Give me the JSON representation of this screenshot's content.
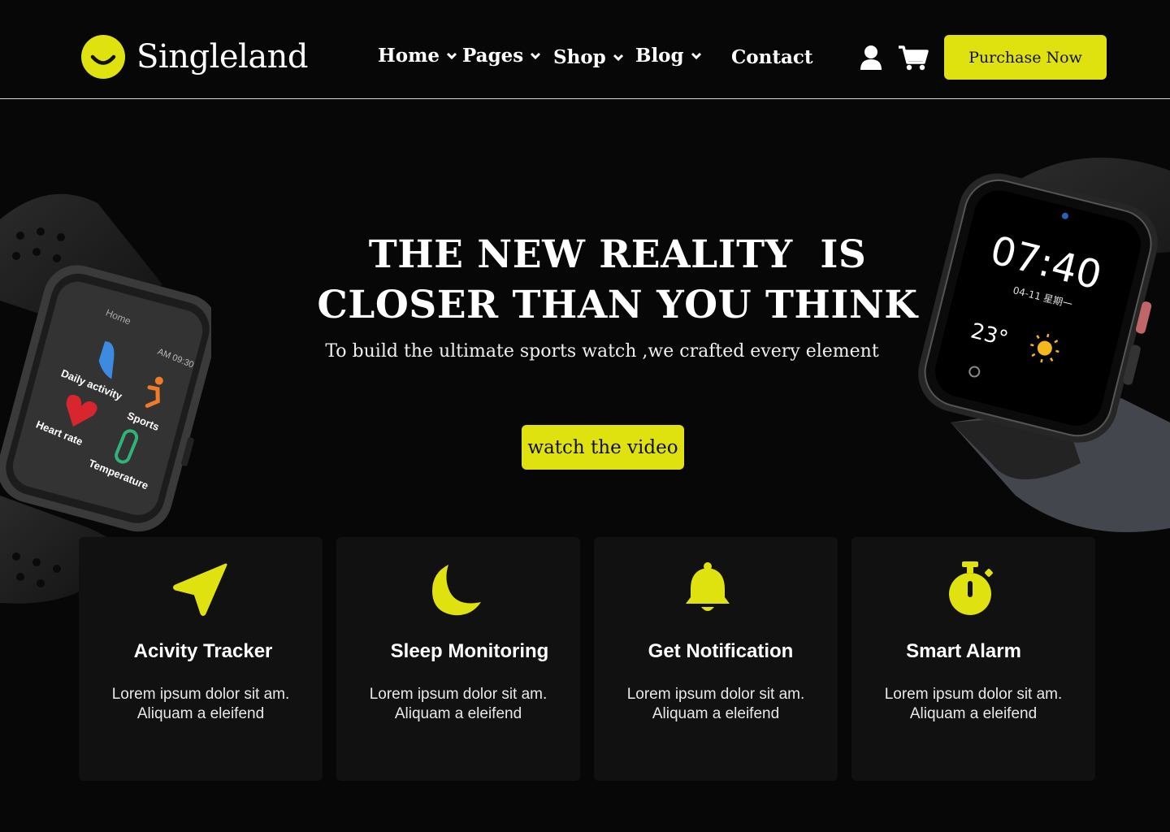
{
  "brand": {
    "name": "Singleland",
    "accent": "#dfe20f",
    "background": "#070707"
  },
  "nav": {
    "items": [
      {
        "label": "Home",
        "has_dropdown": true
      },
      {
        "label": "Pages",
        "has_dropdown": true
      },
      {
        "label": "Shop",
        "has_dropdown": true
      },
      {
        "label": "Blog",
        "has_dropdown": true
      },
      {
        "label": "Contact",
        "has_dropdown": false
      }
    ],
    "icons": [
      "user-icon",
      "cart-icon"
    ],
    "purchase_label": "Purchase Now"
  },
  "hero": {
    "title_line1": "THE NEW REALITY  IS",
    "title_line2": "CLOSER THAN YOU THINK",
    "subtitle": "To build the ultimate sports watch ,we crafted every element",
    "cta_label": "watch the video",
    "left_watch": {
      "screen_title": "Home",
      "time": "AM 09:30",
      "apps": [
        "Daily activity",
        "Sports",
        "Heart rate",
        "Temperature"
      ]
    },
    "right_watch": {
      "time": "07:40",
      "date": "04-11 星期一",
      "temperature": "23°"
    }
  },
  "features": [
    {
      "icon": "navigation-arrow-icon",
      "title": "Acivity Tracker",
      "line1": "Lorem ipsum dolor sit am.",
      "line2": "Aliquam a eleifend"
    },
    {
      "icon": "moon-icon",
      "title": "Sleep Monitoring",
      "line1": "Lorem ipsum dolor sit am.",
      "line2": "Aliquam a eleifend"
    },
    {
      "icon": "bell-icon",
      "title": "Get Notification",
      "line1": "Lorem ipsum dolor sit am.",
      "line2": "Aliquam a eleifend"
    },
    {
      "icon": "stopwatch-icon",
      "title": "Smart Alarm",
      "line1": "Lorem ipsum dolor sit am.",
      "line2": "Aliquam a eleifend"
    }
  ]
}
